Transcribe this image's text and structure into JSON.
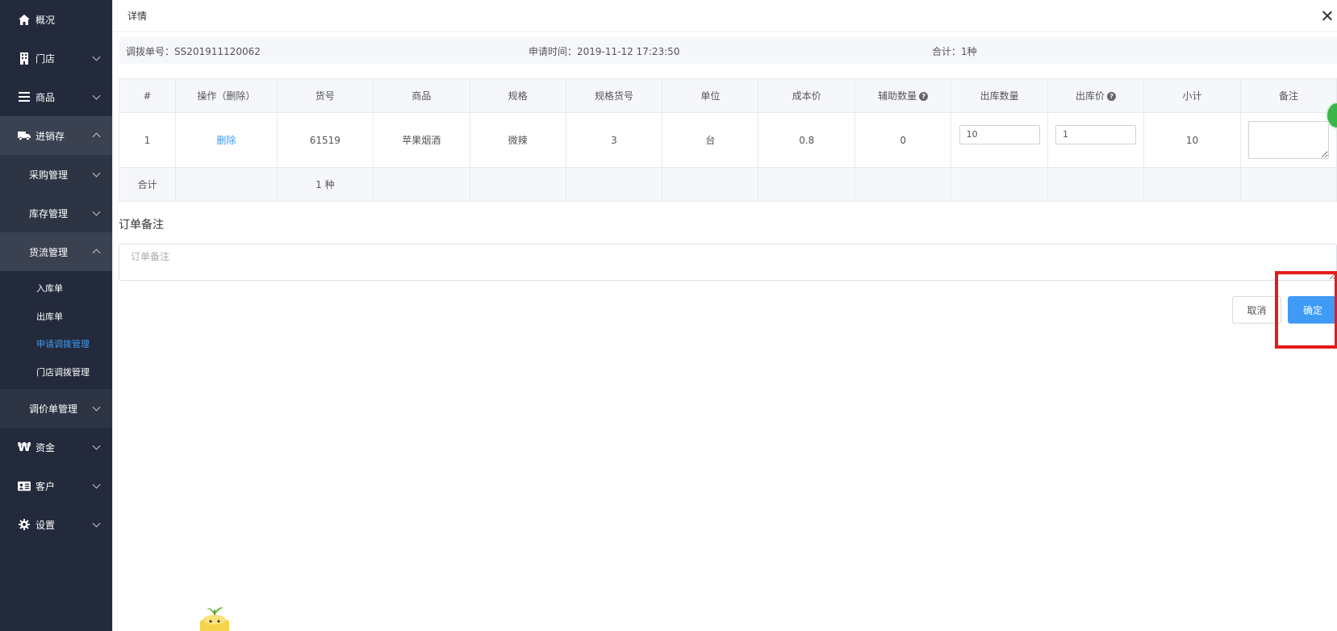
{
  "sidebar": {
    "items": [
      {
        "label": "概况",
        "icon": "home-icon"
      },
      {
        "label": "门店",
        "icon": "building-icon"
      },
      {
        "label": "商品",
        "icon": "list-icon"
      },
      {
        "label": "进销存",
        "icon": "truck-icon"
      },
      {
        "label": "资金",
        "icon": "won-icon"
      },
      {
        "label": "客户",
        "icon": "id-card-icon"
      },
      {
        "label": "设置",
        "icon": "gear-icon"
      }
    ],
    "inventory_sub": [
      {
        "label": "采购管理"
      },
      {
        "label": "库存管理"
      },
      {
        "label": "货流管理"
      },
      {
        "label": "调价单管理"
      }
    ],
    "flow_sub": [
      {
        "label": "入库单"
      },
      {
        "label": "出库单"
      },
      {
        "label": "申请调拨管理"
      },
      {
        "label": "门店调拨管理"
      }
    ]
  },
  "dialog": {
    "title": "详情"
  },
  "info": {
    "order_no": "调拨单号：SS201911120062",
    "apply_time": "申请时间：2019-11-12 17:23:50",
    "total": "合计：1种"
  },
  "table": {
    "headers": [
      "#",
      "操作（删除）",
      "货号",
      "商品",
      "规格",
      "规格货号",
      "单位",
      "成本价",
      "辅助数量",
      "出库数量",
      "出库价",
      "小计",
      "备注"
    ],
    "row": {
      "index": "1",
      "action": "删除",
      "sku": "61519",
      "product": "苹果烟酒",
      "spec": "微辣",
      "spec_sku": "3",
      "unit": "台",
      "cost": "0.8",
      "aux_qty": "0",
      "out_qty": "10",
      "out_price": "1",
      "subtotal": "10",
      "note": ""
    },
    "footer": {
      "label": "合计",
      "count": "1 种"
    }
  },
  "remark": {
    "title": "订单备注",
    "placeholder": "订单备注"
  },
  "buttons": {
    "cancel": "取消",
    "ok": "确定"
  },
  "colors": {
    "sidebar_bg": "#232a3b",
    "accent": "#3f9bf5",
    "highlight": "#e21b1b"
  }
}
